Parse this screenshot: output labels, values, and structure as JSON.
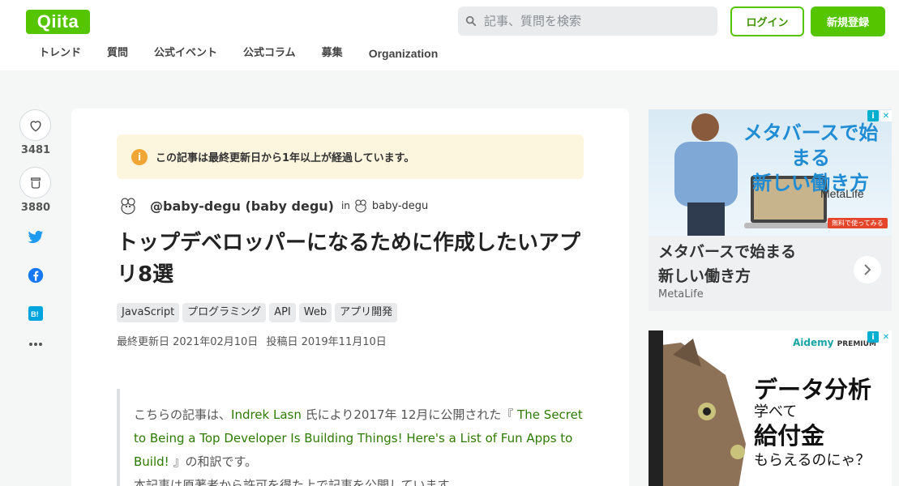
{
  "header": {
    "logo": "Qiita",
    "search_placeholder": "記事、質問を検索",
    "login": "ログイン",
    "signup": "新規登録",
    "nav": [
      "トレンド",
      "質問",
      "公式イベント",
      "公式コラム",
      "募集",
      "Organization"
    ]
  },
  "side": {
    "like_count": "3481",
    "stock_count": "3880"
  },
  "article": {
    "notice": "この記事は最終更新日から1年以上が経過しています。",
    "author": "@baby-degu (baby degu)",
    "in_label": "in",
    "org": "baby-degu",
    "title": "トップデベロッパーになるために作成したいアプリ8選",
    "tags": [
      "JavaScript",
      "プログラミング",
      "API",
      "Web",
      "アプリ開発"
    ],
    "updated": "最終更新日 2021年02月10日",
    "posted": "投稿日 2019年11月10日",
    "quote": {
      "p1_a": "こちらの記事は、",
      "p1_author": "Indrek Lasn",
      "p1_b": " 氏により2017年 12月に公開された『 ",
      "p1_link": "The Secret to Being a Top Developer Is Building Things! Here's a List of Fun Apps to Build!",
      "p1_c": " 』の和訳です。",
      "p2": "本記事は原著者から許可を得た上で記事を公開しています。"
    }
  },
  "ads": {
    "ad1_head_1": "メタバースで始まる",
    "ad1_head_2": "新しい働き方",
    "ad1_logo": "MetaLife",
    "ad1_caption_1": "メタバースで始まる",
    "ad1_caption_2": "新しい働き方",
    "ad1_source": "MetaLife",
    "ad1_trial": "無料で使ってみる",
    "ad2_brand": "Aidemy",
    "ad2_brand_sub": "PREMIUM",
    "ad2_line1": "データ分析",
    "ad2_line2": "学べて",
    "ad2_line3": "給付金",
    "ad2_line4": "もらえるのにゃ？"
  },
  "colors": {
    "brand_green": "#55c500",
    "notice_bg": "#fdf6df",
    "link_green": "#2e7a00"
  }
}
